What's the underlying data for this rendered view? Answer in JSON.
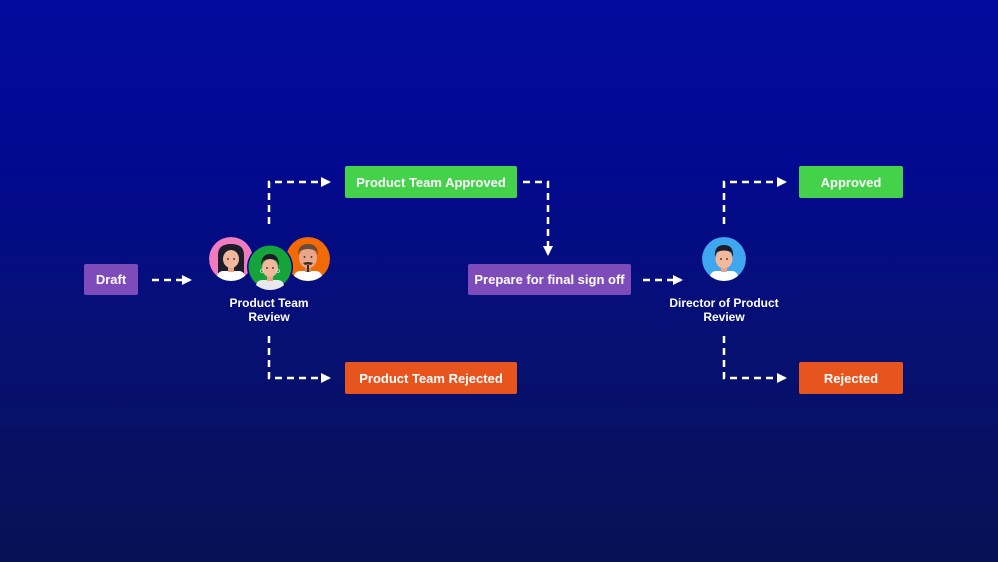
{
  "colors": {
    "purple": "#7e4cba",
    "green": "#43d24a",
    "orange": "#e8541e",
    "avatar_pink": "#f07cbf",
    "avatar_green": "#14a43a",
    "avatar_orange": "#f26a06",
    "avatar_blue": "#3fa6f0"
  },
  "nodes": {
    "draft": "Draft",
    "product_team_review": [
      "Product Team",
      "Review"
    ],
    "product_team_approved": "Product Team Approved",
    "product_team_rejected": "Product Team Rejected",
    "prepare_final_signoff": "Prepare for final sign off",
    "director_review": [
      "Director of Product",
      "Review"
    ],
    "approved": "Approved",
    "rejected": "Rejected"
  },
  "avatars": {
    "product_team": [
      "woman-long-hair-avatar",
      "woman-earrings-avatar",
      "man-beard-avatar"
    ],
    "director": [
      "man-short-hair-avatar"
    ]
  }
}
